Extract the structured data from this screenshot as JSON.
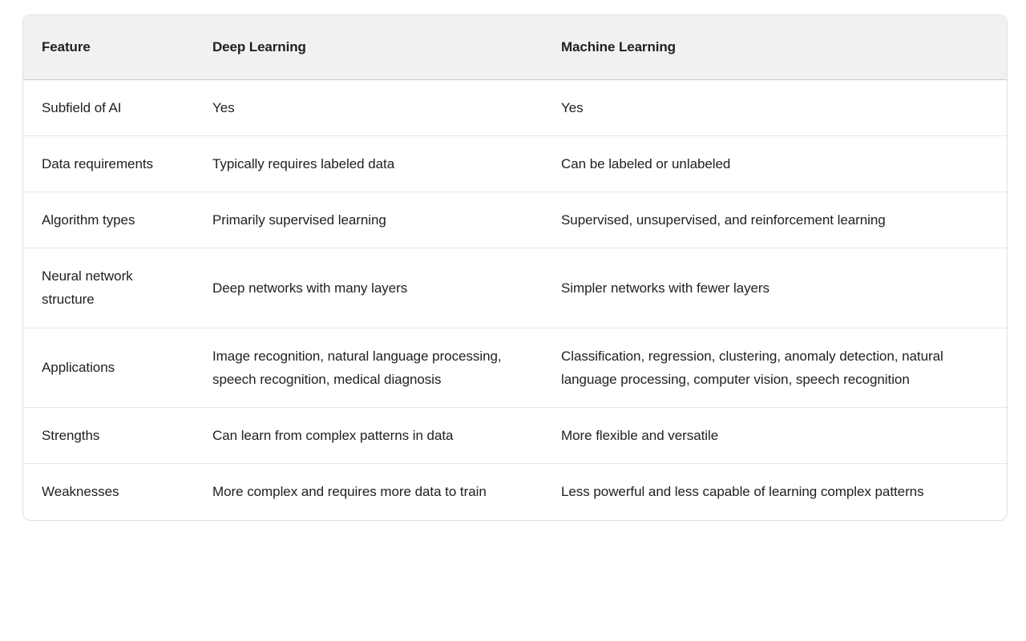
{
  "table": {
    "columns": [
      {
        "key": "feature",
        "label": "Feature"
      },
      {
        "key": "deep_learning",
        "label": "Deep Learning"
      },
      {
        "key": "machine_learning",
        "label": "Machine Learning"
      }
    ],
    "rows": [
      {
        "feature": "Subfield of AI",
        "deep_learning": "Yes",
        "machine_learning": "Yes"
      },
      {
        "feature": "Data requirements",
        "deep_learning": "Typically requires labeled data",
        "machine_learning": "Can be labeled or unlabeled"
      },
      {
        "feature": "Algorithm types",
        "deep_learning": "Primarily supervised learning",
        "machine_learning": "Supervised, unsupervised, and reinforcement learning"
      },
      {
        "feature": "Neural network structure",
        "deep_learning": "Deep networks with many layers",
        "machine_learning": "Simpler networks with fewer layers"
      },
      {
        "feature": "Applications",
        "deep_learning": "Image recognition, natural language processing, speech recognition, medical diagnosis",
        "machine_learning": "Classification, regression, clustering, anomaly detection, natural language processing, computer vision, speech recognition"
      },
      {
        "feature": "Strengths",
        "deep_learning": "Can learn from complex patterns in data",
        "machine_learning": "More flexible and versatile"
      },
      {
        "feature": "Weaknesses",
        "deep_learning": "More complex and requires more data to train",
        "machine_learning": "Less powerful and less capable of learning complex patterns"
      }
    ]
  },
  "colors": {
    "page_background": "#ffffff",
    "header_background": "#f1f1f1",
    "header_text": "#1f1f1f",
    "body_text": "#202124",
    "card_border": "#e0e0e0",
    "row_divider": "#e6e6e6",
    "header_divider": "#c9c9c9"
  }
}
